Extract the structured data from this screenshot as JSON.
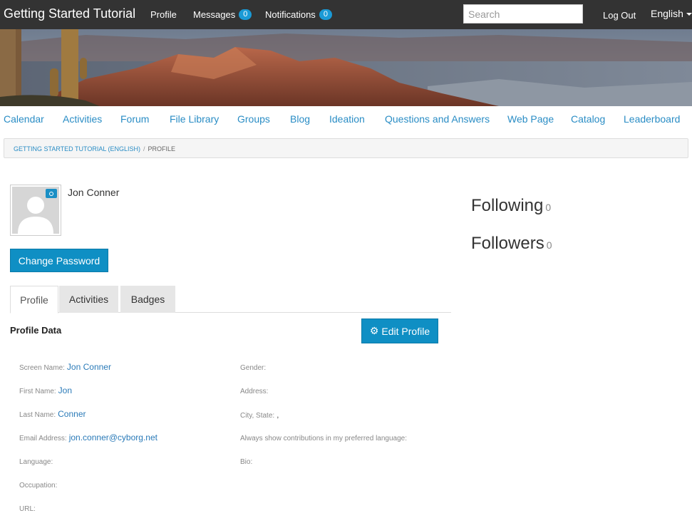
{
  "topbar": {
    "brand": "Getting Started Tutorial",
    "profile": "Profile",
    "messages": "Messages",
    "messages_count": "0",
    "notifications": "Notifications",
    "notifications_count": "0",
    "search_placeholder": "Search",
    "logout": "Log Out",
    "language": "English"
  },
  "nav": {
    "calendar": "Calendar",
    "activities": "Activities",
    "forum": "Forum",
    "file_library": "File Library",
    "groups": "Groups",
    "blog": "Blog",
    "ideation": "Ideation",
    "qa": "Questions and Answers",
    "web_page": "Web Page",
    "catalog": "Catalog",
    "leaderboard": "Leaderboard"
  },
  "breadcrumb": {
    "root": "Getting Started Tutorial (English)",
    "separator": "/",
    "current": "Profile"
  },
  "profile": {
    "name": "Jon Conner",
    "change_password": "Change Password",
    "following_label": "Following",
    "following_count": "0",
    "followers_label": "Followers",
    "followers_count": "0"
  },
  "tabs": {
    "profile": "Profile",
    "activities": "Activities",
    "badges": "Badges"
  },
  "profile_data": {
    "title": "Profile Data",
    "edit_button": "Edit Profile",
    "screen_name_label": "Screen Name:",
    "screen_name": "Jon Conner",
    "first_name_label": "First Name:",
    "first_name": "Jon",
    "last_name_label": "Last Name:",
    "last_name": "Conner",
    "email_label": "Email Address:",
    "email": "jon.conner@cyborg.net",
    "language_label": "Language:",
    "occupation_label": "Occupation:",
    "url_label": "URL:",
    "gender_label": "Gender:",
    "address_label": "Address:",
    "city_state_label": "City, State:",
    "city_state": ",",
    "always_show_label": "Always show contributions in my preferred language:",
    "bio_label": "Bio:"
  },
  "colors": {
    "topbar": "#333333",
    "accent": "#0f8fc4",
    "link": "#2a8dc5"
  }
}
